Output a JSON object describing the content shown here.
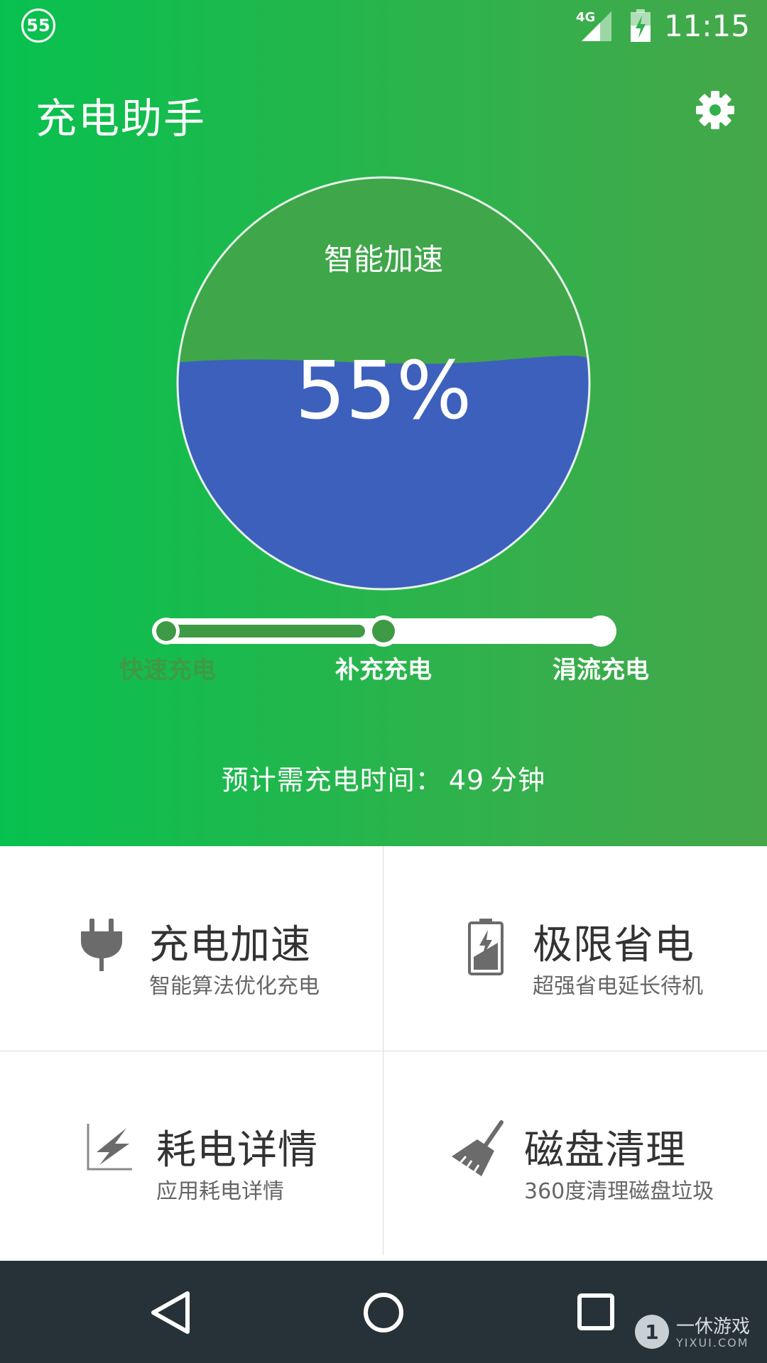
{
  "status_bar": {
    "badge": "55",
    "network": "4G",
    "time": "11:15"
  },
  "app": {
    "title": "充电助手"
  },
  "gauge": {
    "label": "智能加速",
    "percent_text": "55%",
    "level": 0.55
  },
  "stages": [
    {
      "label": "快速充电"
    },
    {
      "label": "补充充电"
    },
    {
      "label": "涓流充电"
    }
  ],
  "eta": {
    "prefix": "预计需充电时间：",
    "value": "49",
    "unit": "分钟"
  },
  "features": [
    {
      "title": "充电加速",
      "subtitle": "智能算法优化充电",
      "icon": "plug-icon"
    },
    {
      "title": "极限省电",
      "subtitle": "超强省电延长待机",
      "icon": "battery-saver-icon"
    },
    {
      "title": "耗电详情",
      "subtitle": "应用耗电详情",
      "icon": "power-chart-icon"
    },
    {
      "title": "磁盘清理",
      "subtitle": "360度清理磁盘垃圾",
      "icon": "broom-icon"
    }
  ],
  "watermark": {
    "name": "一休游戏",
    "domain": "YIXUI.COM"
  },
  "colors": {
    "green": "#2fb24c",
    "dark_green": "#3e9a45",
    "water": "#3d60bd",
    "nav": "#263238"
  }
}
